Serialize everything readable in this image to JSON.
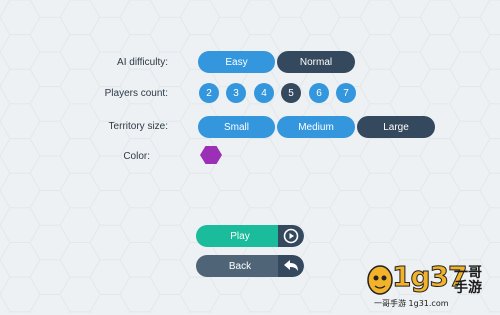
{
  "settings": {
    "ai_difficulty": {
      "label": "AI difficulty:",
      "options": [
        "Easy",
        "Normal"
      ],
      "selected": "Normal"
    },
    "players_count": {
      "label": "Players count:",
      "options": [
        "2",
        "3",
        "4",
        "5",
        "6",
        "7"
      ],
      "selected": "5"
    },
    "territory_size": {
      "label": "Territory size:",
      "options": [
        "Small",
        "Medium",
        "Large"
      ],
      "selected": "Large"
    },
    "color": {
      "label": "Color:",
      "value": "#9b2fb5"
    }
  },
  "actions": {
    "play_label": "Play",
    "back_label": "Back"
  },
  "watermark": {
    "logo_text": "1g37",
    "brand": "一哥手游",
    "tagline": "一哥手游 1g31.com"
  },
  "colors": {
    "selected": "#34495e",
    "unselected": "#3497de",
    "play": "#1abc9c",
    "back": "#506477",
    "background": "#edf1f3"
  }
}
